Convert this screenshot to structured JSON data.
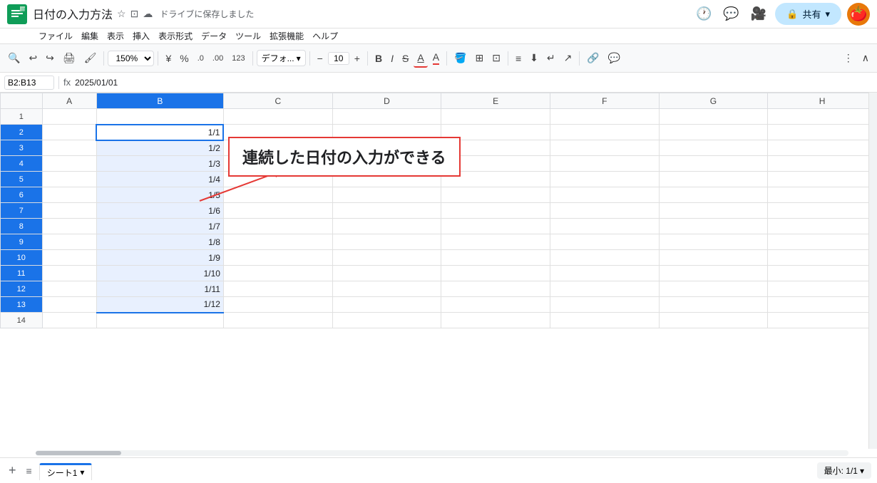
{
  "titleBar": {
    "docTitle": "日付の入力方法",
    "saveStatus": "ドライブに保存しました",
    "menuItems": [
      "ファイル",
      "編集",
      "表示",
      "挿入",
      "表示形式",
      "データ",
      "ツール",
      "拡張機能",
      "ヘルプ"
    ],
    "shareLabel": "共有",
    "shareLockIcon": "🔒"
  },
  "toolbar": {
    "zoom": "150%",
    "currencySymbol": "¥",
    "percentSymbol": "%",
    "decimalIncrease": ".0",
    "decimalDecrease": ".00",
    "numberFormat": "123",
    "fontFamily": "デフォ...",
    "fontSize": "10",
    "boldLabel": "B",
    "italicLabel": "I",
    "strikethroughLabel": "S",
    "underlineLabel": "A"
  },
  "formulaBar": {
    "cellRef": "B2:B13",
    "formula": "2025/01/01"
  },
  "columns": {
    "rowNumWidth": 46,
    "headers": [
      "",
      "A",
      "B",
      "C",
      "D",
      "E",
      "F",
      "G",
      "H"
    ],
    "widths": [
      46,
      60,
      140,
      120,
      120,
      120,
      120,
      120,
      120
    ]
  },
  "rows": [
    {
      "num": "1",
      "data": [
        "",
        "",
        "",
        "",
        "",
        "",
        "",
        ""
      ]
    },
    {
      "num": "2",
      "data": [
        "",
        "1/1",
        "",
        "",
        "",
        "",
        "",
        ""
      ]
    },
    {
      "num": "3",
      "data": [
        "",
        "1/2",
        "",
        "",
        "",
        "",
        "",
        ""
      ]
    },
    {
      "num": "4",
      "data": [
        "",
        "1/3",
        "",
        "",
        "",
        "",
        "",
        ""
      ]
    },
    {
      "num": "5",
      "data": [
        "",
        "1/4",
        "",
        "",
        "",
        "",
        "",
        ""
      ]
    },
    {
      "num": "6",
      "data": [
        "",
        "1/5",
        "",
        "",
        "",
        "",
        "",
        ""
      ]
    },
    {
      "num": "7",
      "data": [
        "",
        "1/6",
        "",
        "",
        "",
        "",
        "",
        ""
      ]
    },
    {
      "num": "8",
      "data": [
        "",
        "1/7",
        "",
        "",
        "",
        "",
        "",
        ""
      ]
    },
    {
      "num": "9",
      "data": [
        "",
        "1/8",
        "",
        "",
        "",
        "",
        "",
        ""
      ]
    },
    {
      "num": "10",
      "data": [
        "",
        "1/9",
        "",
        "",
        "",
        "",
        "",
        ""
      ]
    },
    {
      "num": "11",
      "data": [
        "",
        "1/10",
        "",
        "",
        "",
        "",
        "",
        ""
      ]
    },
    {
      "num": "12",
      "data": [
        "",
        "1/11",
        "",
        "",
        "",
        "",
        "",
        ""
      ]
    },
    {
      "num": "13",
      "data": [
        "",
        "1/12",
        "",
        "",
        "",
        "",
        "",
        ""
      ]
    },
    {
      "num": "14",
      "data": [
        "",
        "",
        "",
        "",
        "",
        "",
        "",
        ""
      ]
    }
  ],
  "annotation": {
    "text": "連続した日付の入力ができる"
  },
  "bottomBar": {
    "addSheetIcon": "+",
    "sheetListIcon": "≡",
    "sheetName": "シート1",
    "statusFormula": "最小: 1/1",
    "dropdownIcon": "▾"
  }
}
